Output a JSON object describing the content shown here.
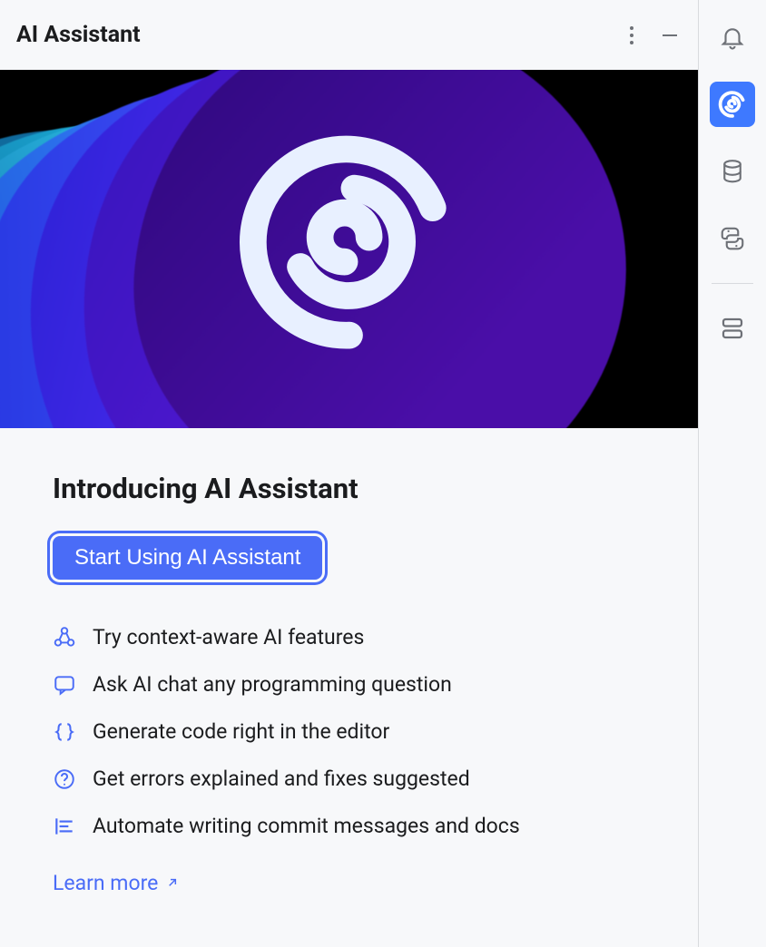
{
  "header": {
    "title": "AI Assistant"
  },
  "intro": {
    "heading": "Introducing AI Assistant",
    "cta_label": "Start Using AI Assistant",
    "learn_more_label": "Learn more"
  },
  "features": [
    {
      "icon": "cluster-icon",
      "text": "Try context-aware AI features"
    },
    {
      "icon": "chat-icon",
      "text": "Ask AI chat any programming question"
    },
    {
      "icon": "braces-icon",
      "text": "Generate code right in the editor"
    },
    {
      "icon": "question-circle-icon",
      "text": "Get errors explained and fixes suggested"
    },
    {
      "icon": "format-left-icon",
      "text": "Automate writing commit messages and docs"
    }
  ],
  "right_rail": {
    "items": [
      {
        "name": "bell-icon",
        "active": false
      },
      {
        "name": "swirl-icon",
        "active": true
      },
      {
        "name": "database-icon",
        "active": false
      },
      {
        "name": "python-icon",
        "active": false
      }
    ],
    "bottom": {
      "name": "panels-icon"
    }
  },
  "colors": {
    "accent": "#4a6cf7",
    "text": "#1b1c1e",
    "muted": "#6e7177",
    "background": "#f7f8fa"
  }
}
